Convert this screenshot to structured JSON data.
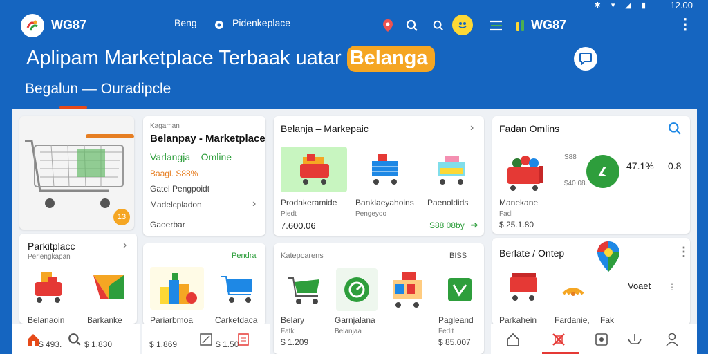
{
  "status": {
    "icons": "✱ ▾ ◢ ▮",
    "time": "12.00"
  },
  "topbar": {
    "brand": "WG87",
    "nav1": "Beng",
    "nav2": "Pidenkeplace",
    "brand2": "WG87"
  },
  "hero": {
    "title_main": "Aplipam Marketplace Terbaak uatar ",
    "title_pill": "Belanga",
    "subtitle": "Begalun — Ouradipcle"
  },
  "card_cart": {
    "badge": "13"
  },
  "card_marketplace": {
    "kicker": "Kagaman",
    "title": "Belanpay - Marketplace",
    "green_line": "Varlangja – Omline",
    "orange_line": "Baagl. S88%",
    "line1": "Gatel Pengpoidt",
    "line2": "Madelcpladon",
    "line3": "Gaoerbar"
  },
  "card_belanja": {
    "title": "Belanja – Markepaic",
    "items": [
      {
        "label": "Prodakeramide",
        "sub": "Piedt"
      },
      {
        "label": "Banklaeyahoins",
        "sub": "Pengeyoo"
      },
      {
        "label": "Paenoldids",
        "sub": ""
      }
    ],
    "price": "7.600.06",
    "link": "S88 08by"
  },
  "card_fashion": {
    "title": "Fadan Omlins",
    "small1": "S88",
    "small2": "$40 08.",
    "pct": "47.1%",
    "val": "0.8",
    "name": "Manekane",
    "sub": "Fadl",
    "price": "$ 25.1.80"
  },
  "card_parkt": {
    "title": "Parkitplacc",
    "sub": "Perlengkapan",
    "items": [
      {
        "label": "Belanaoin",
        "price": "$ 493."
      },
      {
        "label": "Barkanke",
        "price": "$ 1.830"
      }
    ]
  },
  "card_toys": {
    "tag": "Pendra",
    "items": [
      {
        "label": "Pariarbmoa",
        "price": "$ 1.869"
      },
      {
        "label": "Carketdaca",
        "price": "$ 1.50"
      }
    ]
  },
  "card_kat": {
    "kicker": "Katepcarens",
    "tag": "BISS",
    "items": [
      {
        "label": "Belary",
        "sub": "Fatk",
        "price": "$ 1.209"
      },
      {
        "label": "Garnjalana",
        "sub": "Belanjaa",
        "price": ""
      },
      {
        "label": "Pagleand",
        "sub": "Fedit",
        "price": "$ 85.007"
      }
    ]
  },
  "card_belate": {
    "title": "Berlate / Ontep",
    "items": [
      {
        "label": "Parkahein"
      },
      {
        "label": "Fardanie,"
      },
      {
        "label": "Fak"
      }
    ],
    "side": "Voaet"
  },
  "colors": {
    "primary": "#1565c0",
    "accent": "#f5a623",
    "green": "#2e9e3c",
    "red": "#e53935"
  }
}
